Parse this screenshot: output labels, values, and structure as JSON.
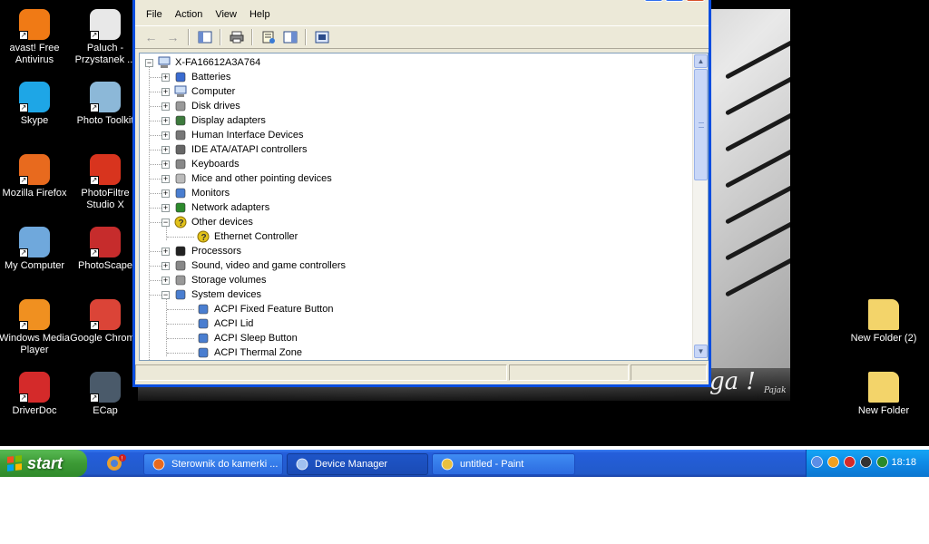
{
  "desktop": {
    "icons": [
      {
        "label": "avast! Free Antivirus",
        "icon": "avast-icon",
        "color": "#f07a15"
      },
      {
        "label": "Paluch - Przystanek ...",
        "icon": "document-icon",
        "color": "#e8e8e8"
      },
      {
        "label": "Skype",
        "icon": "skype-icon",
        "color": "#1ea6e6"
      },
      {
        "label": "Photo Toolkit",
        "icon": "photo-toolkit-icon",
        "color": "#8cb8d8"
      },
      {
        "label": "Mozilla Firefox",
        "icon": "firefox-icon",
        "color": "#e86a1e"
      },
      {
        "label": "PhotoFiltre Studio X",
        "icon": "photofiltre-icon",
        "color": "#d8341e"
      },
      {
        "label": "My Computer",
        "icon": "my-computer-icon",
        "color": "#6fa8dc"
      },
      {
        "label": "PhotoScape",
        "icon": "photoscape-icon",
        "color": "#c62c2c"
      },
      {
        "label": "Windows Media Player",
        "icon": "media-player-icon",
        "color": "#f09020"
      },
      {
        "label": "Google Chrome",
        "icon": "chrome-icon",
        "color": "#db4437"
      },
      {
        "label": "DriverDoc",
        "icon": "driverdoc-icon",
        "color": "#d42a2a"
      },
      {
        "label": "ECap",
        "icon": "camera-icon",
        "color": "#4a5a6a"
      },
      {
        "label": "New Folder (2)",
        "icon": "folder-icon",
        "color": "#f3d46a"
      },
      {
        "label": "New Folder",
        "icon": "folder-icon",
        "color": "#f3d46a"
      }
    ],
    "wallpaper_text": "ga !",
    "wallpaper_signature": "Pajak"
  },
  "window": {
    "menu": [
      "File",
      "Action",
      "View",
      "Help"
    ],
    "toolbar": [
      {
        "icon": "back-arrow-icon",
        "enabled": false
      },
      {
        "icon": "forward-arrow-icon",
        "enabled": false
      },
      {
        "icon": "show-hide-tree-icon",
        "enabled": true
      },
      {
        "icon": "print-icon",
        "enabled": true
      },
      {
        "icon": "properties-icon",
        "enabled": true
      },
      {
        "icon": "help-icon",
        "enabled": true
      },
      {
        "icon": "scan-hardware-icon",
        "enabled": true
      }
    ],
    "tree": {
      "root": "X-FA16612A3A764",
      "items": [
        {
          "label": "Batteries",
          "expanded": false,
          "icon": "battery-icon"
        },
        {
          "label": "Computer",
          "expanded": false,
          "icon": "computer-icon"
        },
        {
          "label": "Disk drives",
          "expanded": false,
          "icon": "disk-drive-icon"
        },
        {
          "label": "Display adapters",
          "expanded": false,
          "icon": "display-adapter-icon"
        },
        {
          "label": "Human Interface Devices",
          "expanded": false,
          "icon": "hid-icon"
        },
        {
          "label": "IDE ATA/ATAPI controllers",
          "expanded": false,
          "icon": "ide-controller-icon"
        },
        {
          "label": "Keyboards",
          "expanded": false,
          "icon": "keyboard-icon"
        },
        {
          "label": "Mice and other pointing devices",
          "expanded": false,
          "icon": "mouse-icon"
        },
        {
          "label": "Monitors",
          "expanded": false,
          "icon": "monitor-icon"
        },
        {
          "label": "Network adapters",
          "expanded": false,
          "icon": "network-adapter-icon"
        },
        {
          "label": "Other devices",
          "expanded": true,
          "icon": "unknown-device-icon",
          "children": [
            {
              "label": "Ethernet Controller",
              "icon": "warning-device-icon"
            }
          ]
        },
        {
          "label": "Processors",
          "expanded": false,
          "icon": "processor-icon"
        },
        {
          "label": "Sound, video and game controllers",
          "expanded": false,
          "icon": "sound-icon"
        },
        {
          "label": "Storage volumes",
          "expanded": false,
          "icon": "storage-volume-icon"
        },
        {
          "label": "System devices",
          "expanded": true,
          "icon": "system-device-icon",
          "children": [
            {
              "label": "ACPI Fixed Feature Button",
              "icon": "system-device-icon"
            },
            {
              "label": "ACPI Lid",
              "icon": "system-device-icon"
            },
            {
              "label": "ACPI Sleep Button",
              "icon": "system-device-icon"
            },
            {
              "label": "ACPI Thermal Zone",
              "icon": "system-device-icon"
            }
          ]
        }
      ]
    }
  },
  "taskbar": {
    "start_label": "start",
    "tasks": [
      {
        "label": "Sterownik do kamerki ...",
        "icon": "firefox-icon",
        "active": false
      },
      {
        "label": "Device Manager",
        "icon": "device-manager-icon",
        "active": true
      },
      {
        "label": "untitled - Paint",
        "icon": "paint-icon",
        "active": false
      }
    ],
    "tray_icons": [
      "show-hidden-icons-icon",
      "avast-tray-icon",
      "security-alert-icon",
      "network-icon",
      "safely-remove-icon"
    ],
    "clock": "18:18"
  },
  "colors": {
    "accent": "#0a4ee0",
    "start_green": "#3c9a35",
    "taskbar_blue": "#245edb",
    "tray_blue": "#0e8ae6"
  }
}
